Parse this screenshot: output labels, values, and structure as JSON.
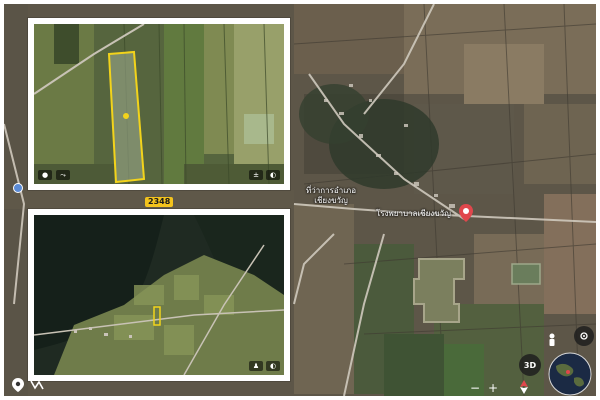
{
  "main_map": {
    "place_label_line1": "ที่ว่าการอำเภอ",
    "place_label_line2": "เชียงขวัญ",
    "hospital_label": "โรงพยาบาลเชียงขวัญ",
    "road_number": "2348"
  },
  "controls": {
    "view_3d_label": "3D",
    "zoom_in_label": "+",
    "zoom_out_label": "−"
  },
  "colors": {
    "parcel_outline": "#f2d31b",
    "place_pin": "#e0474c",
    "road_shield": "#f3c31d"
  }
}
